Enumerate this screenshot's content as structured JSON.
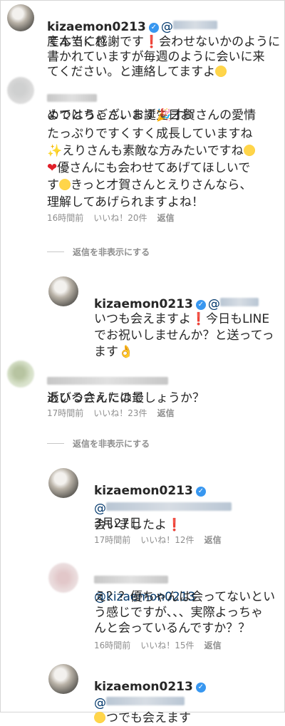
{
  "comments": [
    {
      "username": "kizaemon0213",
      "text_l1": "産んでくれ",
      "text_l2": "て本当に感謝です",
      "text_l2b": "会わせないかのように",
      "text_l3": "書かれていますが毎週のように会いに来",
      "text_l4": "てください。と連絡してますよ"
    },
    {
      "text_l1": "よつはちゃん、お誕生日お",
      "text_l2": "めでとうございます",
      "text_l2b": "才賀さんの愛情",
      "text_l3": "たっぷりですくすく成長していますね",
      "text_l4": "えりさんも素敵な方みたいですね",
      "text_l5": "優さんにも会わせてあげてほしいで",
      "text_l6": "す",
      "text_l6b": "きっと才賀さんとえりさんなら、",
      "text_l7": "理解してあげられますよね！",
      "meta": {
        "time": "16時間前",
        "likes": "いいね！20件",
        "reply": "返信"
      },
      "hide_replies": "返信を非表示にする"
    },
    {
      "username": "kizaemon0213",
      "text_l1": "いつも会えますよ",
      "text_l1b": "今日もLINE",
      "text_l2": "でお祝いしませんか？と送ってっ",
      "text_l3": "ます"
    },
    {
      "username_blur": "maho____maho___maho",
      "text_l1": "あびるさんには最",
      "text_l2": "近いつ会えたのでしょうか？",
      "meta": {
        "time": "17時間前",
        "likes": "いいね！23件",
        "reply": "返信"
      },
      "hide_replies": "返信を非表示にする"
    },
    {
      "username": "kizaemon0213",
      "mention_blur": "@maho___maho___maho",
      "text_l1b": "3月27日",
      "text_l2": "会いましたよ",
      "meta": {
        "time": "17時間前",
        "likes": "いいね！12件",
        "reply": "返信"
      }
    },
    {
      "mention": "@kizaemon0213",
      "text_l1": "え？？優ちゃんは会ってないとい",
      "text_l2": "う感じですが、、、実際よっちゃ",
      "text_l3": "んと会っているんですか？？",
      "meta": {
        "time": "16時間前",
        "likes": "いいね！15件",
        "reply": "返信"
      }
    },
    {
      "username": "kizaemon0213",
      "text_l1": "いつでも会えます"
    }
  ],
  "icons": {
    "verified": "✓",
    "exclaim": "❗",
    "heart": "❤",
    "sparkles": "✨",
    "party": "🎉",
    "ok": "👌"
  }
}
